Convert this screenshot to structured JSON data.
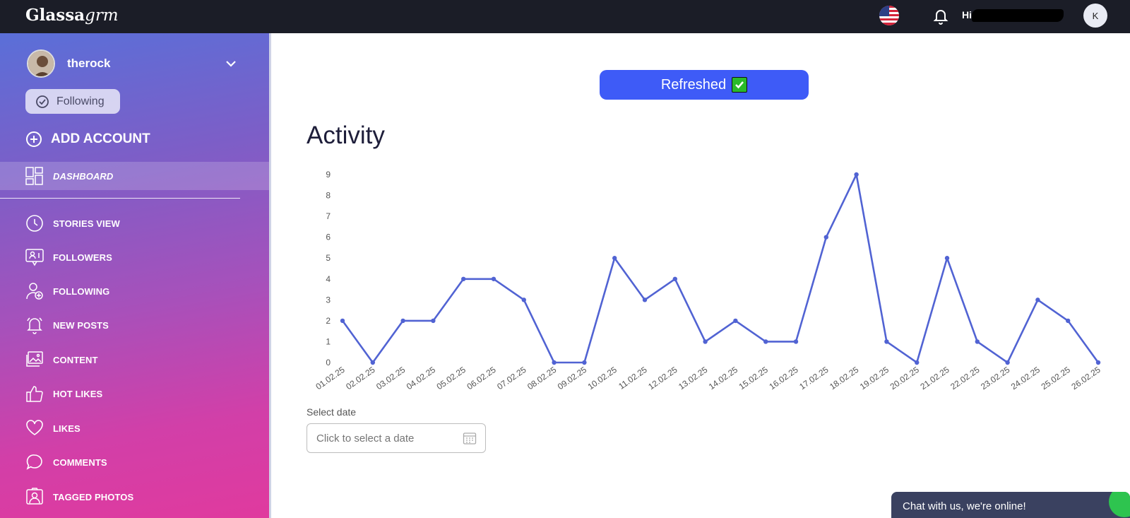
{
  "app": {
    "logo_bold": "Glassa",
    "logo_italic": "grm",
    "user_name": "Hi",
    "avatar_initial": "K"
  },
  "sidebar": {
    "account_name": "therock",
    "following_label": "Following",
    "add_account_label": "ADD ACCOUNT",
    "dashboard_label": "DASHBOARD",
    "items": [
      {
        "label": "STORIES VIEW",
        "icon": "clock-icon"
      },
      {
        "label": "FOLLOWERS",
        "icon": "followers-icon"
      },
      {
        "label": "FOLLOWING",
        "icon": "user-add-icon"
      },
      {
        "label": "NEW POSTS",
        "icon": "bell-icon"
      },
      {
        "label": "CONTENT",
        "icon": "image-icon"
      },
      {
        "label": "HOT LIKES",
        "icon": "thumbs-up-icon"
      },
      {
        "label": "LIKES",
        "icon": "heart-icon"
      },
      {
        "label": "COMMENTS",
        "icon": "comment-icon"
      },
      {
        "label": "TAGGED PHOTOS",
        "icon": "tagged-photo-icon"
      }
    ]
  },
  "main": {
    "refresh_label": "Refreshed",
    "title": "Activity",
    "date_label": "Select date",
    "date_placeholder": "Click to select a date"
  },
  "chat": {
    "label": "Chat with us, we're online!"
  },
  "colors": {
    "line": "#5163d3",
    "accent": "#3e5bf7"
  },
  "chart_data": {
    "type": "line",
    "x": [
      "01.02.25",
      "02.02.25",
      "03.02.25",
      "04.02.25",
      "05.02.25",
      "06.02.25",
      "07.02.25",
      "08.02.25",
      "09.02.25",
      "10.02.25",
      "11.02.25",
      "12.02.25",
      "13.02.25",
      "14.02.25",
      "15.02.25",
      "16.02.25",
      "17.02.25",
      "18.02.25",
      "19.02.25",
      "20.02.25",
      "21.02.25",
      "22.02.25",
      "23.02.25",
      "24.02.25",
      "25.02.25",
      "26.02.25"
    ],
    "values": [
      2,
      0,
      2,
      2,
      4,
      4,
      3,
      0,
      0,
      5,
      3,
      4,
      1,
      2,
      1,
      1,
      6,
      9,
      1,
      0,
      5,
      1,
      0,
      3,
      2,
      0
    ],
    "yticks": [
      "0",
      "1",
      "2",
      "3",
      "4",
      "5",
      "6",
      "7",
      "8",
      "9"
    ],
    "ylim": [
      0,
      9
    ],
    "grid": false,
    "legend": "none"
  }
}
